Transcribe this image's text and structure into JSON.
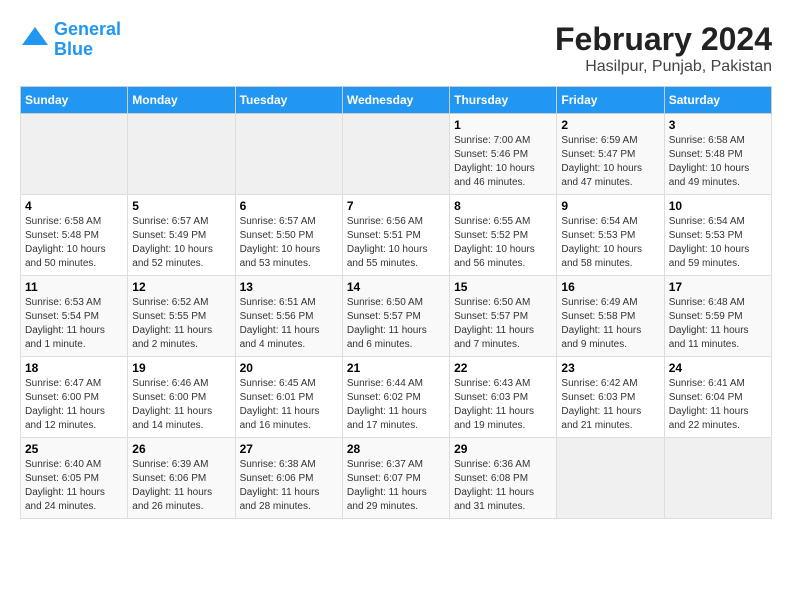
{
  "header": {
    "logo_line1": "General",
    "logo_line2": "Blue",
    "title": "February 2024",
    "subtitle": "Hasilpur, Punjab, Pakistan"
  },
  "days_of_week": [
    "Sunday",
    "Monday",
    "Tuesday",
    "Wednesday",
    "Thursday",
    "Friday",
    "Saturday"
  ],
  "weeks": [
    [
      {
        "num": "",
        "info": ""
      },
      {
        "num": "",
        "info": ""
      },
      {
        "num": "",
        "info": ""
      },
      {
        "num": "",
        "info": ""
      },
      {
        "num": "1",
        "info": "Sunrise: 7:00 AM\nSunset: 5:46 PM\nDaylight: 10 hours\nand 46 minutes."
      },
      {
        "num": "2",
        "info": "Sunrise: 6:59 AM\nSunset: 5:47 PM\nDaylight: 10 hours\nand 47 minutes."
      },
      {
        "num": "3",
        "info": "Sunrise: 6:58 AM\nSunset: 5:48 PM\nDaylight: 10 hours\nand 49 minutes."
      }
    ],
    [
      {
        "num": "4",
        "info": "Sunrise: 6:58 AM\nSunset: 5:48 PM\nDaylight: 10 hours\nand 50 minutes."
      },
      {
        "num": "5",
        "info": "Sunrise: 6:57 AM\nSunset: 5:49 PM\nDaylight: 10 hours\nand 52 minutes."
      },
      {
        "num": "6",
        "info": "Sunrise: 6:57 AM\nSunset: 5:50 PM\nDaylight: 10 hours\nand 53 minutes."
      },
      {
        "num": "7",
        "info": "Sunrise: 6:56 AM\nSunset: 5:51 PM\nDaylight: 10 hours\nand 55 minutes."
      },
      {
        "num": "8",
        "info": "Sunrise: 6:55 AM\nSunset: 5:52 PM\nDaylight: 10 hours\nand 56 minutes."
      },
      {
        "num": "9",
        "info": "Sunrise: 6:54 AM\nSunset: 5:53 PM\nDaylight: 10 hours\nand 58 minutes."
      },
      {
        "num": "10",
        "info": "Sunrise: 6:54 AM\nSunset: 5:53 PM\nDaylight: 10 hours\nand 59 minutes."
      }
    ],
    [
      {
        "num": "11",
        "info": "Sunrise: 6:53 AM\nSunset: 5:54 PM\nDaylight: 11 hours\nand 1 minute."
      },
      {
        "num": "12",
        "info": "Sunrise: 6:52 AM\nSunset: 5:55 PM\nDaylight: 11 hours\nand 2 minutes."
      },
      {
        "num": "13",
        "info": "Sunrise: 6:51 AM\nSunset: 5:56 PM\nDaylight: 11 hours\nand 4 minutes."
      },
      {
        "num": "14",
        "info": "Sunrise: 6:50 AM\nSunset: 5:57 PM\nDaylight: 11 hours\nand 6 minutes."
      },
      {
        "num": "15",
        "info": "Sunrise: 6:50 AM\nSunset: 5:57 PM\nDaylight: 11 hours\nand 7 minutes."
      },
      {
        "num": "16",
        "info": "Sunrise: 6:49 AM\nSunset: 5:58 PM\nDaylight: 11 hours\nand 9 minutes."
      },
      {
        "num": "17",
        "info": "Sunrise: 6:48 AM\nSunset: 5:59 PM\nDaylight: 11 hours\nand 11 minutes."
      }
    ],
    [
      {
        "num": "18",
        "info": "Sunrise: 6:47 AM\nSunset: 6:00 PM\nDaylight: 11 hours\nand 12 minutes."
      },
      {
        "num": "19",
        "info": "Sunrise: 6:46 AM\nSunset: 6:00 PM\nDaylight: 11 hours\nand 14 minutes."
      },
      {
        "num": "20",
        "info": "Sunrise: 6:45 AM\nSunset: 6:01 PM\nDaylight: 11 hours\nand 16 minutes."
      },
      {
        "num": "21",
        "info": "Sunrise: 6:44 AM\nSunset: 6:02 PM\nDaylight: 11 hours\nand 17 minutes."
      },
      {
        "num": "22",
        "info": "Sunrise: 6:43 AM\nSunset: 6:03 PM\nDaylight: 11 hours\nand 19 minutes."
      },
      {
        "num": "23",
        "info": "Sunrise: 6:42 AM\nSunset: 6:03 PM\nDaylight: 11 hours\nand 21 minutes."
      },
      {
        "num": "24",
        "info": "Sunrise: 6:41 AM\nSunset: 6:04 PM\nDaylight: 11 hours\nand 22 minutes."
      }
    ],
    [
      {
        "num": "25",
        "info": "Sunrise: 6:40 AM\nSunset: 6:05 PM\nDaylight: 11 hours\nand 24 minutes."
      },
      {
        "num": "26",
        "info": "Sunrise: 6:39 AM\nSunset: 6:06 PM\nDaylight: 11 hours\nand 26 minutes."
      },
      {
        "num": "27",
        "info": "Sunrise: 6:38 AM\nSunset: 6:06 PM\nDaylight: 11 hours\nand 28 minutes."
      },
      {
        "num": "28",
        "info": "Sunrise: 6:37 AM\nSunset: 6:07 PM\nDaylight: 11 hours\nand 29 minutes."
      },
      {
        "num": "29",
        "info": "Sunrise: 6:36 AM\nSunset: 6:08 PM\nDaylight: 11 hours\nand 31 minutes."
      },
      {
        "num": "",
        "info": ""
      },
      {
        "num": "",
        "info": ""
      }
    ]
  ]
}
